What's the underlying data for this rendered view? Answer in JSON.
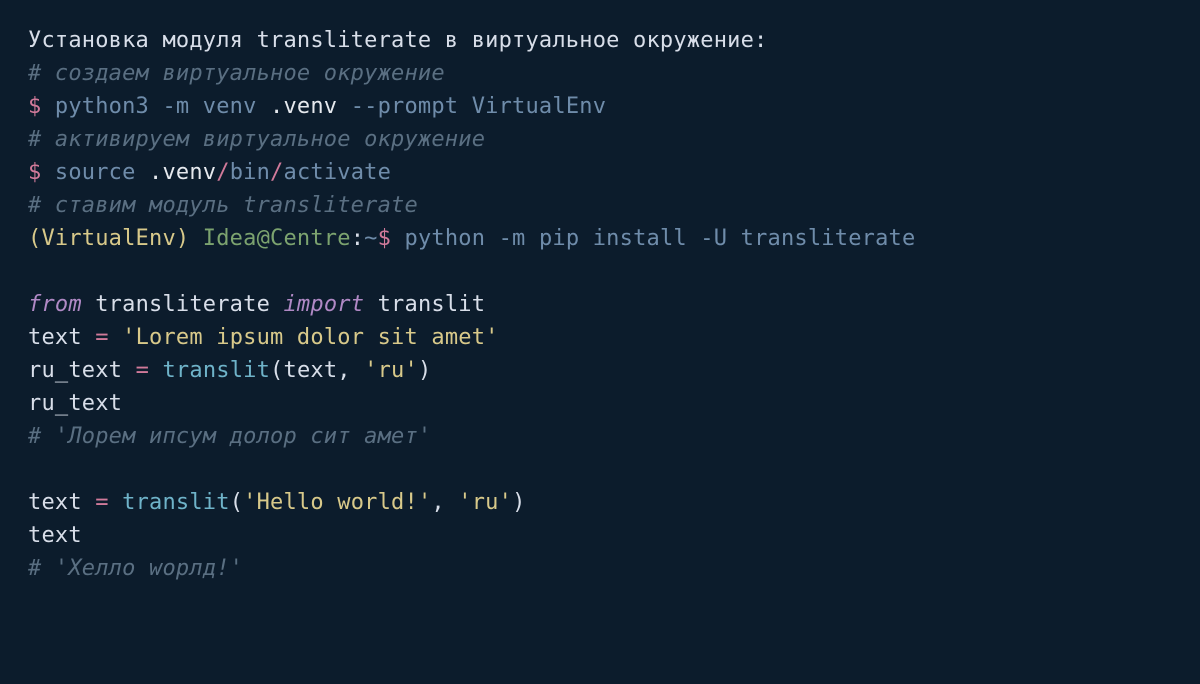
{
  "intro": "Установка модуля transliterate в виртуальное окружение:",
  "comment1": "# создаем виртуальное окружение",
  "line1": {
    "prompt": "$ ",
    "cmd_a": "python3 -m venv ",
    "cmd_b": ".venv",
    "cmd_c": " --prompt VirtualEnv"
  },
  "comment2": "# активируем виртуальное окружение",
  "line2": {
    "prompt": "$ ",
    "cmd_a": "source ",
    "cmd_b": ".venv",
    "slash1": "/",
    "seg1": "bin",
    "slash2": "/",
    "seg2": "activate"
  },
  "comment3": "# ставим модуль transliterate",
  "line3": {
    "env": "(VirtualEnv) ",
    "host": "Idea@Centre",
    "colon": ":",
    "tilde": "~",
    "prompt": "$ ",
    "cmd": "python -m pip install -U transliterate"
  },
  "py": {
    "l1": {
      "from": "from",
      "sp1": " ",
      "mod1": "transliterate",
      "sp2": " ",
      "import": "import",
      "sp3": " ",
      "mod2": "translit"
    },
    "l2": {
      "var": "text",
      "sp1": " ",
      "eq": "=",
      "sp2": " ",
      "str": "'Lorem ipsum dolor sit amet'"
    },
    "l3": {
      "var": "ru_text",
      "sp1": " ",
      "eq": "=",
      "sp2": " ",
      "fn": "translit",
      "lp": "(",
      "arg1": "text",
      "comma": ", ",
      "arg2": "'ru'",
      "rp": ")"
    },
    "l4": {
      "var": "ru_text"
    },
    "l5": "# 'Лорем ипсум долор сит амет'",
    "l6": {
      "var": "text",
      "sp1": " ",
      "eq": "=",
      "sp2": " ",
      "fn": "translit",
      "lp": "(",
      "arg1": "'Hello world!'",
      "comma": ", ",
      "arg2": "'ru'",
      "rp": ")"
    },
    "l7": {
      "var": "text"
    },
    "l8": "# 'Хелло wорлд!'"
  }
}
